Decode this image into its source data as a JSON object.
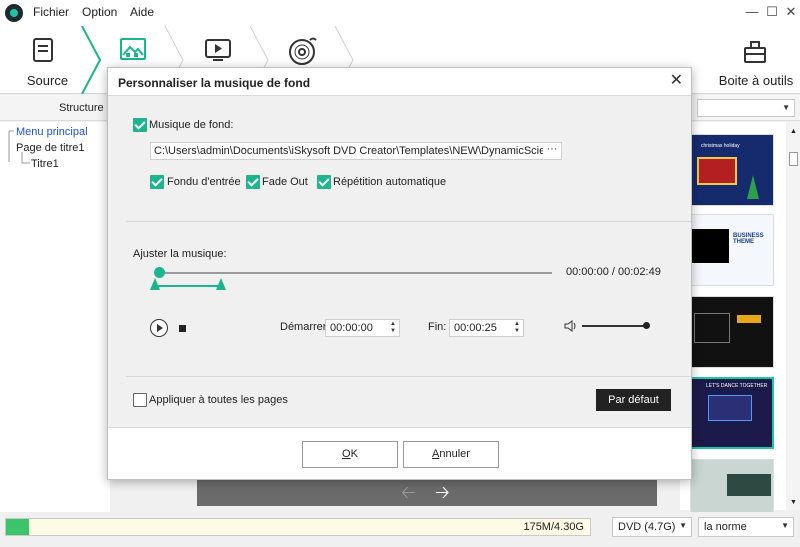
{
  "menu": [
    "Fichier",
    "Option",
    "Aide"
  ],
  "toolbar": {
    "source_label": "Source",
    "toolbox_label": "Boite à outils"
  },
  "structure_label": "Structure d",
  "tree": {
    "root": "Menu principal",
    "page": "Page de titre1",
    "child": "Titre1"
  },
  "thumbs": [
    {
      "caption": "christmas holiday"
    },
    {
      "caption": "BUSINESS THEME"
    },
    {
      "caption": ""
    },
    {
      "caption": "LET'S DANCE TOGETHER"
    },
    {
      "caption": ""
    }
  ],
  "status": {
    "capacity_text": "175M/4.30G",
    "capacity_fraction": 0.04,
    "disc_type": "DVD (4.7G)",
    "quality": "la norme"
  },
  "dialog": {
    "title": "Personnaliser la musique de fond",
    "bg_music_label": "Musique de fond:",
    "bg_music_checked": true,
    "music_path": "C:\\Users\\admin\\Documents\\iSkysoft DVD Creator\\Templates\\NEW\\DynamicScience\\Comm",
    "browse_label": "···",
    "fade_in_label": "Fondu d'entrée",
    "fade_in_checked": true,
    "fade_out_label": "Fade Out",
    "fade_out_checked": true,
    "repeat_label": "Répétition automatique",
    "repeat_checked": true,
    "adjust_label": "Ajuster la musique:",
    "time_readout": "00:00:00 / 00:02:49",
    "start_label": "Démarrer:",
    "start_value": "00:00:00",
    "end_label": "Fin:",
    "end_value": "00:00:25",
    "apply_all_label": "Appliquer à toutes les pages",
    "apply_all_checked": false,
    "default_button": "Par défaut",
    "ok_button": "OK",
    "cancel_button": "Annuler"
  },
  "colors": {
    "accent": "#1cb58d",
    "capacity_fill": "#3cc469"
  }
}
